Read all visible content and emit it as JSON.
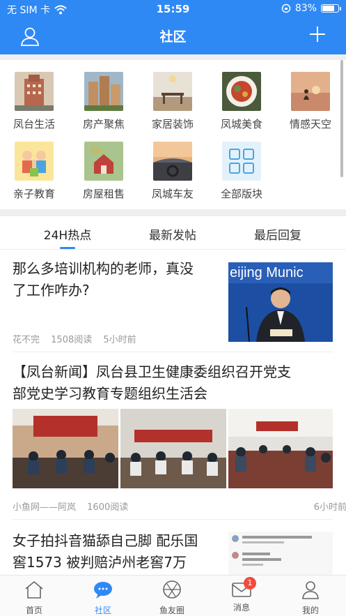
{
  "status_bar": {
    "carrier": "无 SIM 卡",
    "time": "15:59",
    "battery": "83%",
    "battery_level": 0.83
  },
  "nav": {
    "title": "社区"
  },
  "categories": [
    {
      "label": "凤台生活",
      "icon": "city-building-icon",
      "color": "#b7674e"
    },
    {
      "label": "房产聚焦",
      "icon": "apartment-buildings-icon",
      "color": "#c29060"
    },
    {
      "label": "家居装饰",
      "icon": "dining-room-icon",
      "color": "#b39a7e"
    },
    {
      "label": "凤城美食",
      "icon": "food-plate-icon",
      "color": "#6a8c48"
    },
    {
      "label": "情感天空",
      "icon": "sunset-person-icon",
      "color": "#c9896a"
    },
    {
      "label": "亲子教育",
      "icon": "family-cartoon-icon",
      "color": "#f0c14a"
    },
    {
      "label": "房屋租售",
      "icon": "house-keys-icon",
      "color": "#6e9a52"
    },
    {
      "label": "凤城车友",
      "icon": "car-dashboard-icon",
      "color": "#5a5f68"
    },
    {
      "label": "全部版块",
      "icon": "grid-blocks-icon",
      "color": "#4aa4e0"
    }
  ],
  "tabs": [
    {
      "label": "24H热点"
    },
    {
      "label": "最新发帖"
    },
    {
      "label": "最后回复"
    }
  ],
  "posts": [
    {
      "title_line1": "那么多培训机构的老师，真没",
      "title_line2": "了工作咋办?",
      "author": "花不完",
      "reads": "1508阅读",
      "time": "5小时前",
      "image_text": "eijing Munic"
    },
    {
      "title_line1": "【凤台新闻】凤台县卫生健康委组织召开党支",
      "title_line2": "部党史学习教育专题组织生活会",
      "author": "小鱼网——阿岚",
      "reads": "1600阅读",
      "time": "6小时前"
    },
    {
      "title_line1": "女子拍抖音猫舔自己脚 配乐国",
      "title_line2": "窖1573 被判赔泸州老窖7万"
    }
  ],
  "bottom_tabs": [
    {
      "label": "首页",
      "icon": "home-icon"
    },
    {
      "label": "社区",
      "icon": "chat-bubbles-icon"
    },
    {
      "label": "鱼友圈",
      "icon": "aperture-icon"
    },
    {
      "label": "消息",
      "icon": "mail-icon",
      "badge": "1"
    },
    {
      "label": "我的",
      "icon": "person-icon"
    }
  ],
  "colors": {
    "primary": "#2f89f5",
    "badge": "#f24b3c"
  }
}
